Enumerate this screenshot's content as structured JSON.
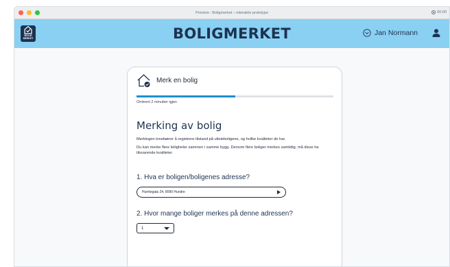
{
  "window": {
    "title": "Preview : Boligmerket – interaktiv prototype",
    "clock": "00:00"
  },
  "header": {
    "logo_line1": "BOLIG",
    "logo_line2": "MERKET",
    "brand": "BOLIGMERKET",
    "user_name": "Jan Normann"
  },
  "card": {
    "step_title": "Merk en bolig",
    "progress_fraction": 0.5,
    "time_left": "Omtrent 2 minutter igjen",
    "heading": "Merking av bolig",
    "paragraph1": "Merkingen innebærer å registrere tilstand på utleieboligene, og hvilke kvaliteter de har.",
    "paragraph2": "Du kan merke flere leiligheter sammen i samme bygg. Dersom flere boliger merkes samtidig, må disse ha tilsvarende kvaliteter.",
    "question1": "1. Hva er boligen/boligenes adresse?",
    "address_value": "Humlegata 24, 8090 Hundre",
    "question2": "2. Hvor mange boliger merkes på denne adressen?",
    "count_value": "1"
  },
  "colors": {
    "header_bg": "#89d0f3",
    "brand": "#1d3250",
    "progress": "#1e8fd0"
  }
}
